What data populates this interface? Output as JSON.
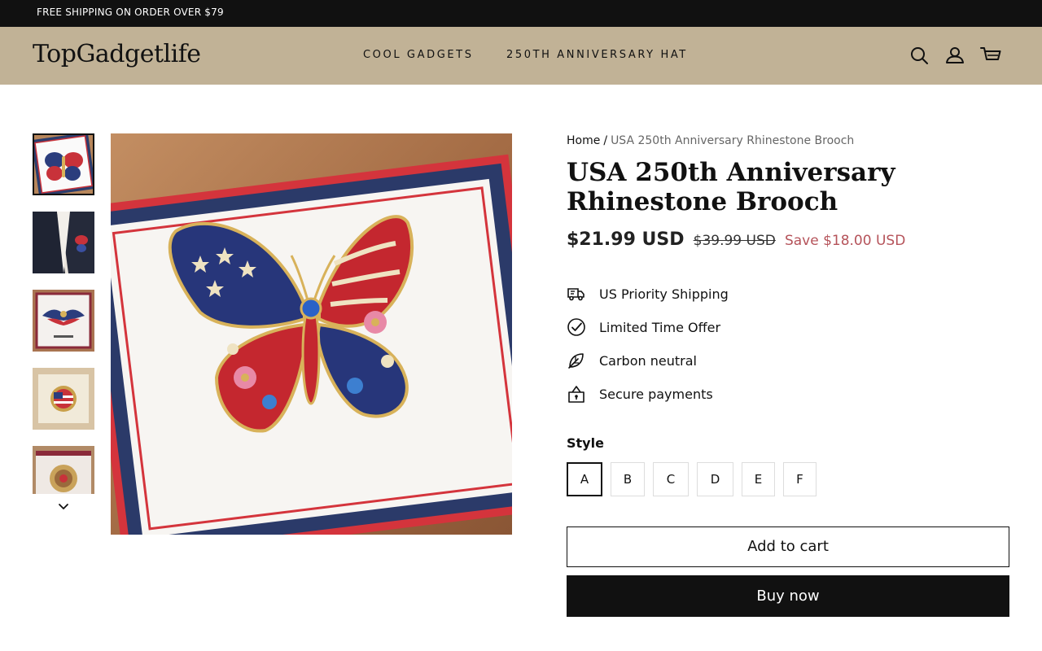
{
  "announcement": {
    "text": "FREE SHIPPING ON ORDER OVER $79"
  },
  "header": {
    "logo": "TopGadgetlife",
    "nav": [
      "COOL GADGETS",
      "250TH ANNIVERSARY HAT"
    ],
    "icons": [
      "search-icon",
      "account-icon",
      "cart-icon"
    ]
  },
  "gallery": {
    "thumbnails": [
      "butterfly brooch",
      "brooch worn on jacket",
      "eagle brooch card",
      "round flag brooch",
      "gold round brooch"
    ],
    "selected_thumbnail": 1
  },
  "product": {
    "breadcrumb": {
      "home": "Home",
      "separator": "/",
      "current": "USA 250th Anniversary Rhinestone Brooch"
    },
    "title": "USA 250th Anniversary Rhinestone Brooch",
    "price": "$21.99 USD",
    "compare_price": "$39.99 USD",
    "savings": "Save $18.00 USD",
    "features": [
      {
        "icon": "truck-icon",
        "text": "US Priority Shipping"
      },
      {
        "icon": "checkmark-circle-icon",
        "text": "Limited Time Offer"
      },
      {
        "icon": "leaf-icon",
        "text": "Carbon neutral"
      },
      {
        "icon": "lock-icon",
        "text": "Secure payments"
      }
    ],
    "style_label": "Style",
    "styles": [
      "A",
      "B",
      "C",
      "D",
      "E",
      "F"
    ],
    "selected_style": "A",
    "add_to_cart": "Add to cart",
    "buy_now": "Buy now"
  },
  "colors": {
    "announcement_bg": "#111111",
    "header_bg": "#c1b296",
    "sale_text": "#b5535a",
    "buy_button_bg": "#111111"
  }
}
